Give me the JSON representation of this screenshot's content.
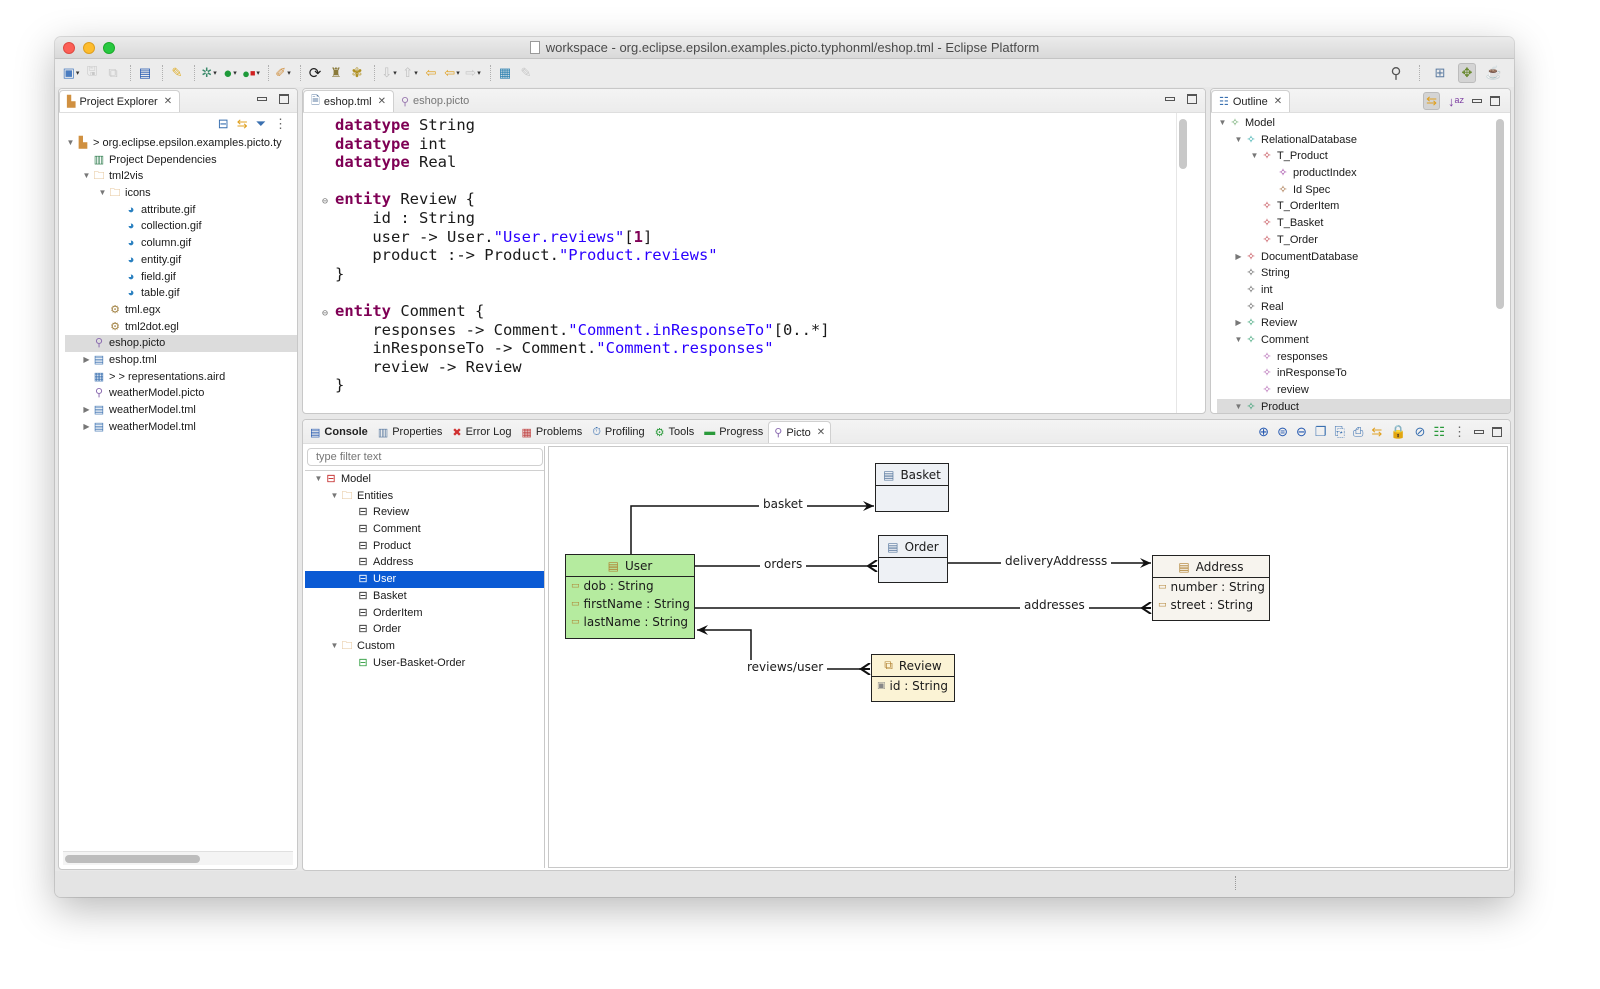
{
  "window": {
    "title": "workspace - org.eclipse.epsilon.examples.picto.typhonml/eshop.tml - Eclipse Platform"
  },
  "toolbar": {
    "icons": [
      "new-icon",
      "save-icon",
      "save-all-icon",
      "console-icon",
      "brush-icon",
      "debug-icon",
      "run-icon",
      "external-tools-icon",
      "pen-icon",
      "refresh-icon",
      "wizard-icon",
      "bee-icon",
      "next-annotation-icon",
      "prev-annotation-icon",
      "last-edit-icon",
      "back-icon",
      "forward-icon",
      "open-task-icon",
      "pin-icon"
    ],
    "right_icons": [
      "search-icon",
      "open-perspective-icon",
      "epsilon-perspective-icon",
      "java-perspective-icon"
    ]
  },
  "project_explorer": {
    "tab_label": "Project Explorer",
    "items": [
      {
        "label": "> org.eclipse.epsilon.examples.picto.ty",
        "depth": 0,
        "expanded": true,
        "icon": "project-icon"
      },
      {
        "label": "Project Dependencies",
        "depth": 1,
        "icon": "library-icon"
      },
      {
        "label": "tml2vis",
        "depth": 1,
        "expanded": true,
        "icon": "folder-icon"
      },
      {
        "label": "icons",
        "depth": 2,
        "expanded": true,
        "icon": "folder-icon"
      },
      {
        "label": "attribute.gif",
        "depth": 3,
        "icon": "gif-icon"
      },
      {
        "label": "collection.gif",
        "depth": 3,
        "icon": "gif-icon"
      },
      {
        "label": "column.gif",
        "depth": 3,
        "icon": "gif-icon"
      },
      {
        "label": "entity.gif",
        "depth": 3,
        "icon": "gif-icon"
      },
      {
        "label": "field.gif",
        "depth": 3,
        "icon": "gif-icon"
      },
      {
        "label": "table.gif",
        "depth": 3,
        "icon": "gif-icon"
      },
      {
        "label": "tml.egx",
        "depth": 2,
        "icon": "gear-file-icon"
      },
      {
        "label": "tml2dot.egl",
        "depth": 2,
        "icon": "gear-file-icon"
      },
      {
        "label": "eshop.picto",
        "depth": 1,
        "icon": "picto-file-icon",
        "selected": true
      },
      {
        "label": "eshop.tml",
        "depth": 1,
        "collapsed": true,
        "icon": "model-file-icon"
      },
      {
        "label": "> > representations.aird",
        "depth": 1,
        "icon": "aird-file-icon"
      },
      {
        "label": "weatherModel.picto",
        "depth": 1,
        "icon": "picto-file-icon"
      },
      {
        "label": "weatherModel.tml",
        "depth": 1,
        "collapsed": true,
        "icon": "model-file-icon"
      },
      {
        "label": "weatherModel.tml",
        "depth": 1,
        "collapsed": true,
        "icon": "model-file-icon"
      }
    ]
  },
  "editor": {
    "tabs": [
      {
        "label": "eshop.tml",
        "active": true
      },
      {
        "label": "eshop.picto",
        "active": false
      }
    ],
    "lines": [
      [
        {
          "t": "datatype",
          "c": "kw"
        },
        {
          "t": " String"
        }
      ],
      [
        {
          "t": "datatype",
          "c": "kw"
        },
        {
          "t": " int"
        }
      ],
      [
        {
          "t": "datatype",
          "c": "kw"
        },
        {
          "t": " Real"
        }
      ],
      [],
      [
        {
          "t": "entity",
          "c": "kw"
        },
        {
          "t": " Review {"
        }
      ],
      [
        {
          "t": "    id : String"
        }
      ],
      [
        {
          "t": "    user -> User."
        },
        {
          "t": "\"User.reviews\"",
          "c": "str"
        },
        {
          "t": "["
        },
        {
          "t": "1",
          "c": "kw"
        },
        {
          "t": "]"
        }
      ],
      [
        {
          "t": "    product :-> Product."
        },
        {
          "t": "\"Product.reviews\"",
          "c": "str"
        }
      ],
      [
        {
          "t": "}"
        }
      ],
      [],
      [
        {
          "t": "entity",
          "c": "kw"
        },
        {
          "t": " Comment {"
        }
      ],
      [
        {
          "t": "    responses -> Comment."
        },
        {
          "t": "\"Comment.inResponseTo\"",
          "c": "str"
        },
        {
          "t": "[0..*]"
        }
      ],
      [
        {
          "t": "    inResponseTo -> Comment."
        },
        {
          "t": "\"Comment.responses\"",
          "c": "str"
        }
      ],
      [
        {
          "t": "    review -> Review"
        }
      ],
      [
        {
          "t": "}"
        }
      ]
    ],
    "fold_lines": [
      4,
      10
    ]
  },
  "outline": {
    "tab_label": "Outline",
    "items": [
      {
        "label": "Model",
        "depth": 0,
        "expanded": true,
        "color": "#6aa86a"
      },
      {
        "label": "RelationalDatabase",
        "depth": 1,
        "expanded": true,
        "color": "#2aa6a6"
      },
      {
        "label": "T_Product",
        "depth": 2,
        "expanded": true,
        "color": "#c0404a"
      },
      {
        "label": "productIndex",
        "depth": 3,
        "color": "#9b3aa0"
      },
      {
        "label": "Id Spec",
        "depth": 3,
        "color": "#a0683a"
      },
      {
        "label": "T_OrderItem",
        "depth": 2,
        "color": "#c0404a"
      },
      {
        "label": "T_Basket",
        "depth": 2,
        "color": "#c0404a"
      },
      {
        "label": "T_Order",
        "depth": 2,
        "color": "#c0404a"
      },
      {
        "label": "DocumentDatabase",
        "depth": 1,
        "collapsed": true,
        "color": "#c0404a"
      },
      {
        "label": "String",
        "depth": 1,
        "color": "#555555"
      },
      {
        "label": "int",
        "depth": 1,
        "color": "#555555"
      },
      {
        "label": "Real",
        "depth": 1,
        "color": "#555555"
      },
      {
        "label": "Review",
        "depth": 1,
        "collapsed": true,
        "color": "#2a9a6a"
      },
      {
        "label": "Comment",
        "depth": 1,
        "expanded": true,
        "color": "#2a9a6a"
      },
      {
        "label": "responses",
        "depth": 2,
        "color": "#b060b0"
      },
      {
        "label": "inResponseTo",
        "depth": 2,
        "color": "#b060b0"
      },
      {
        "label": "review",
        "depth": 2,
        "color": "#b060b0"
      },
      {
        "label": "Product",
        "depth": 1,
        "expanded": true,
        "color": "#2a9a6a",
        "selected": true
      }
    ]
  },
  "bottom": {
    "tabs": [
      {
        "label": "Console",
        "icon": "console-icon",
        "bold": true
      },
      {
        "label": "Properties",
        "icon": "properties-icon"
      },
      {
        "label": "Error Log",
        "icon": "error-log-icon"
      },
      {
        "label": "Problems",
        "icon": "problems-icon"
      },
      {
        "label": "Profiling",
        "icon": "profiling-icon"
      },
      {
        "label": "Tools",
        "icon": "tools-icon"
      },
      {
        "label": "Progress",
        "icon": "progress-icon"
      },
      {
        "label": "Picto",
        "icon": "picto-icon",
        "active": true
      }
    ],
    "toolbar_icons": [
      "zoom-in-icon",
      "zoom-reset-icon",
      "zoom-out-icon",
      "layers-icon",
      "copy-icon",
      "print-icon",
      "sync-icon",
      "lock-icon",
      "hide-icon",
      "view-menu-icon",
      "more-icon"
    ]
  },
  "picto": {
    "filter_placeholder": "type filter text",
    "tree": [
      {
        "label": "Model",
        "depth": 0,
        "expanded": true,
        "icon": "model-view-icon"
      },
      {
        "label": "Entities",
        "depth": 1,
        "expanded": true,
        "icon": "folder-icon"
      },
      {
        "label": "Review",
        "depth": 2,
        "icon": "view-icon"
      },
      {
        "label": "Comment",
        "depth": 2,
        "icon": "view-icon"
      },
      {
        "label": "Product",
        "depth": 2,
        "icon": "view-icon"
      },
      {
        "label": "Address",
        "depth": 2,
        "icon": "view-icon"
      },
      {
        "label": "User",
        "depth": 2,
        "icon": "view-icon",
        "selected": true
      },
      {
        "label": "Basket",
        "depth": 2,
        "icon": "view-icon"
      },
      {
        "label": "OrderItem",
        "depth": 2,
        "icon": "view-icon"
      },
      {
        "label": "Order",
        "depth": 2,
        "icon": "view-icon"
      },
      {
        "label": "Custom",
        "depth": 1,
        "expanded": true,
        "icon": "folder-icon"
      },
      {
        "label": "User-Basket-Order",
        "depth": 2,
        "icon": "custom-view-icon"
      }
    ],
    "diagram": {
      "nodes": {
        "user": {
          "name": "User",
          "attrs": [
            "dob : String",
            "firstName : String",
            "lastName : String"
          ],
          "fill": "#b5eb9f"
        },
        "basket": {
          "name": "Basket",
          "attrs": [],
          "fill": "#eef1f5"
        },
        "order": {
          "name": "Order",
          "attrs": [],
          "fill": "#eef1f5"
        },
        "address": {
          "name": "Address",
          "attrs": [
            "number : String",
            "street : String"
          ],
          "fill": "#f7f4ee"
        },
        "review": {
          "name": "Review",
          "attrs": [
            "id : String"
          ],
          "fill": "#fbf3d5"
        }
      },
      "edges": {
        "basket": "basket",
        "orders": "orders",
        "delivery": "deliveryAddresss",
        "addresses": "addresses",
        "reviews": "reviews/user"
      }
    }
  }
}
